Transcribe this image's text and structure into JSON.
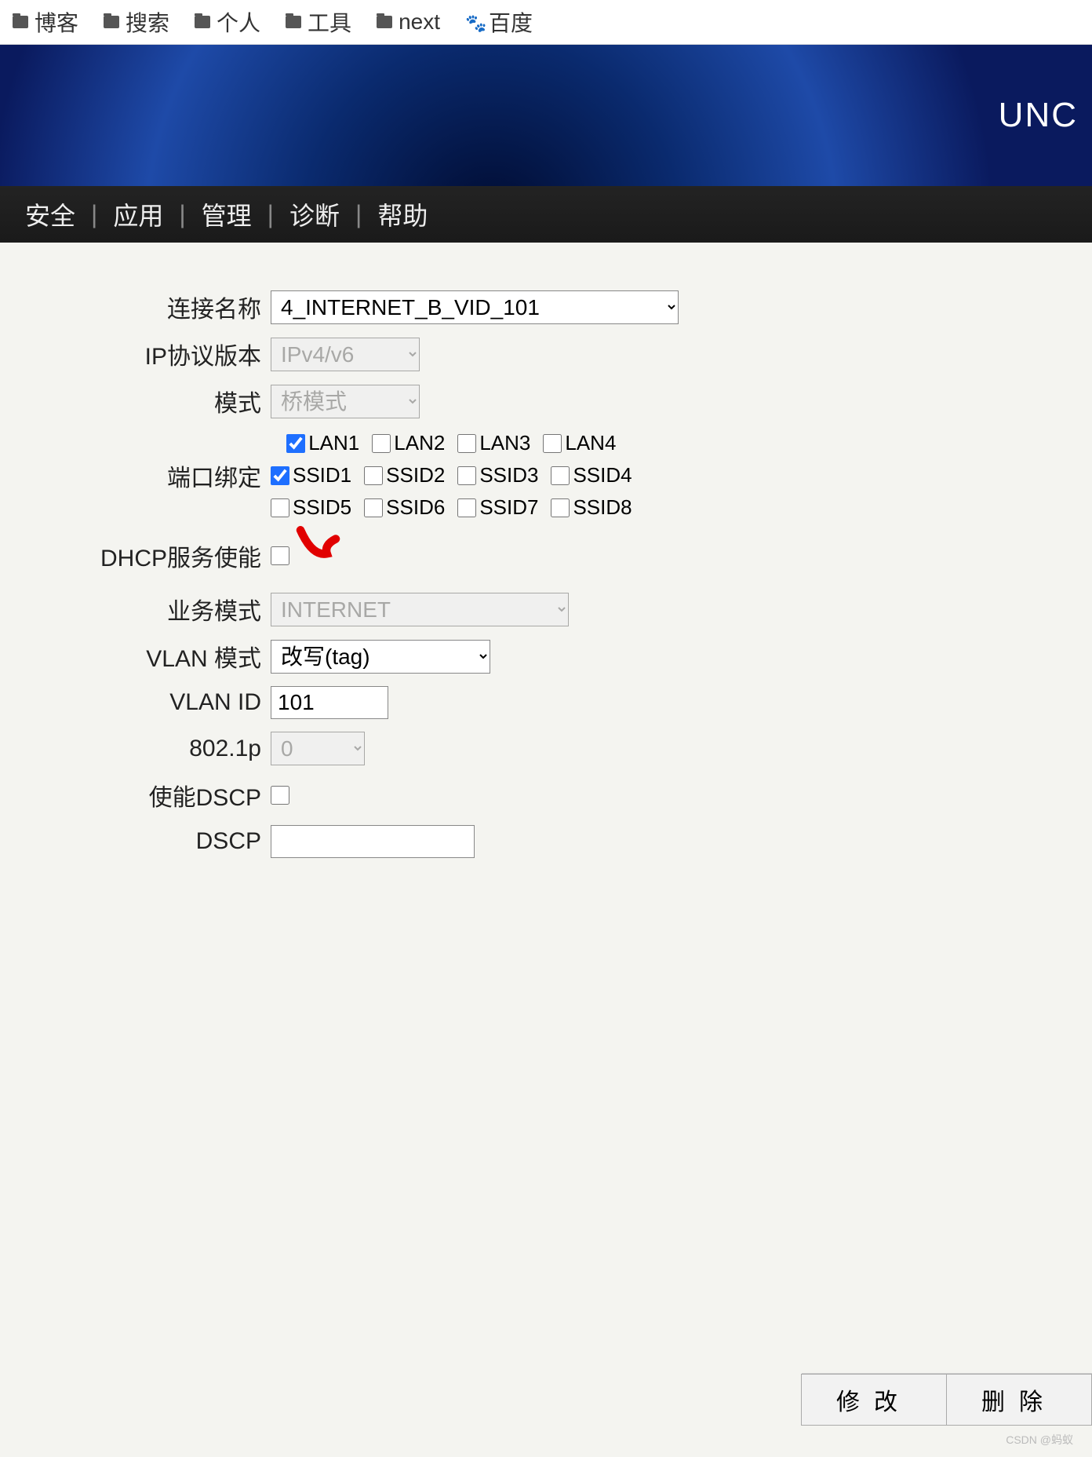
{
  "bookmarks": [
    {
      "label": "博客",
      "icon": "folder"
    },
    {
      "label": "搜索",
      "icon": "folder"
    },
    {
      "label": "个人",
      "icon": "folder"
    },
    {
      "label": "工具",
      "icon": "folder"
    },
    {
      "label": "next",
      "icon": "folder"
    },
    {
      "label": "百度",
      "icon": "baidu"
    }
  ],
  "banner": {
    "brand_partial": "UNC"
  },
  "nav": {
    "items": [
      "安全",
      "应用",
      "管理",
      "诊断",
      "帮助"
    ]
  },
  "form": {
    "connection_name": {
      "label": "连接名称",
      "value": "4_INTERNET_B_VID_101"
    },
    "ip_protocol": {
      "label": "IP协议版本",
      "value": "IPv4/v6"
    },
    "mode": {
      "label": "模式",
      "value": "桥模式"
    },
    "port_binding": {
      "label": "端口绑定",
      "lan": [
        {
          "label": "LAN1",
          "checked": true
        },
        {
          "label": "LAN2",
          "checked": false
        },
        {
          "label": "LAN3",
          "checked": false
        },
        {
          "label": "LAN4",
          "checked": false
        }
      ],
      "ssid1": [
        {
          "label": "SSID1",
          "checked": true
        },
        {
          "label": "SSID2",
          "checked": false
        },
        {
          "label": "SSID3",
          "checked": false
        },
        {
          "label": "SSID4",
          "checked": false
        }
      ],
      "ssid2": [
        {
          "label": "SSID5",
          "checked": false
        },
        {
          "label": "SSID6",
          "checked": false
        },
        {
          "label": "SSID7",
          "checked": false
        },
        {
          "label": "SSID8",
          "checked": false
        }
      ]
    },
    "dhcp": {
      "label": "DHCP服务使能",
      "checked": false
    },
    "service_mode": {
      "label": "业务模式",
      "value": "INTERNET"
    },
    "vlan_mode": {
      "label": "VLAN 模式",
      "value": "改写(tag)"
    },
    "vlan_id": {
      "label": "VLAN ID",
      "value": "101"
    },
    "p8021": {
      "label": "802.1p",
      "value": "0"
    },
    "enable_dscp": {
      "label": "使能DSCP",
      "checked": false
    },
    "dscp": {
      "label": "DSCP",
      "value": ""
    }
  },
  "buttons": {
    "modify": "修改",
    "delete": "删除"
  },
  "watermark": "CSDN @蚂蚁"
}
